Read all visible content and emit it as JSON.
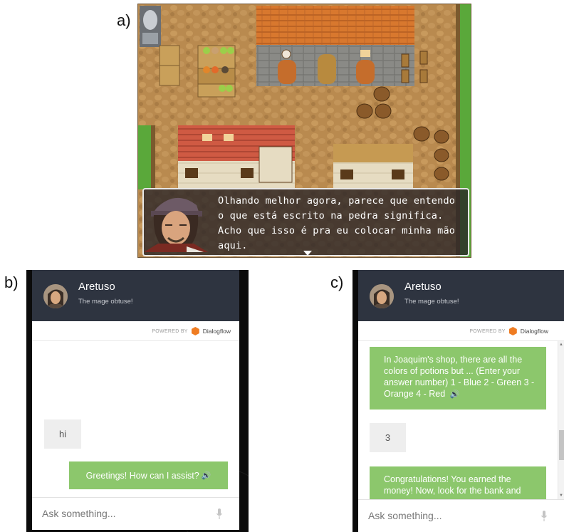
{
  "labels": {
    "a": "a)",
    "b": "b)",
    "c": "c)"
  },
  "game": {
    "dialog_lines": [
      "Olhando melhor agora, parece que entendo",
      "o que está escrito na pedra significa.",
      "Acho que isso é pra eu colocar minha mão",
      "aqui."
    ]
  },
  "chat_b": {
    "agent_name": "Aretuso",
    "agent_desc": "The mage obtuse!",
    "powered_by": "POWERED BY",
    "brand": "Dialogflow",
    "messages": [
      {
        "from": "user",
        "text": "hi"
      },
      {
        "from": "bot",
        "text": "Greetings! How can I assist?"
      }
    ],
    "input_placeholder": "Ask something..."
  },
  "chat_c": {
    "agent_name": "Aretuso",
    "agent_desc": "The mage obtuse!",
    "powered_by": "POWERED BY",
    "brand": "Dialogflow",
    "messages": [
      {
        "from": "bot",
        "text": "In Joaquim's shop, there are all the colors of potions but ... (Enter your answer number) 1 - Blue 2 - Green 3 - Orange 4 - Red"
      },
      {
        "from": "user",
        "text": "3"
      },
      {
        "from": "bot",
        "text": "Congratulations! You earned the money! Now, look for the bank and"
      }
    ],
    "input_placeholder": "Ask something..."
  },
  "icons": {
    "speaker": "speaker-icon",
    "mic": "microphone-icon",
    "brand": "dialogflow-logo-icon"
  },
  "colors": {
    "header_bg": "#2e3440",
    "bot_bubble": "#8cc76c",
    "user_bubble": "#eeeeee",
    "brand_orange": "#ef7c22"
  }
}
